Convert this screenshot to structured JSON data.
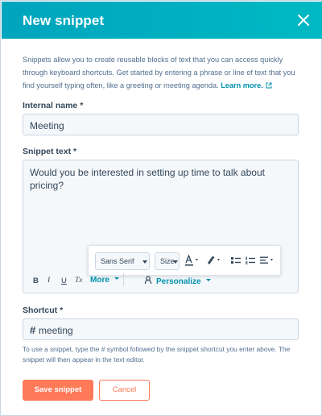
{
  "dialog": {
    "title": "New snippet",
    "close_icon": "close-icon"
  },
  "intro": {
    "text": "Snippets allow you to create reusable blocks of text that you can access quickly through keyboard shortcuts. Get started by entering a phrase or line of text that you find yourself typing often, like a greeting or meeting agenda.",
    "learn_more": "Learn more.",
    "learn_more_icon": "external-link-icon"
  },
  "internal_name": {
    "label": "Internal name *",
    "value": "Meeting"
  },
  "snippet_text": {
    "label": "Snippet text *",
    "value": "Would you be interested in setting up time to talk about pricing?"
  },
  "floating_toolbar": {
    "font_select": "Sans Serif",
    "size_select": "Size",
    "icons": [
      "text-color-icon",
      "highlight-icon",
      "bulleted-list-icon",
      "numbered-list-icon",
      "align-icon"
    ]
  },
  "bottom_toolbar": {
    "bold": "B",
    "italic": "I",
    "underline": "U",
    "clear_format": "Tx",
    "more": "More",
    "personalize": "Personalize",
    "personalize_icon": "personalize-icon"
  },
  "shortcut": {
    "label": "Shortcut *",
    "prefix": "#",
    "value": "meeting"
  },
  "hint": {
    "text": "To use a snippet, type the # symbol followed by the snippet shortcut you enter above. The snippet will then appear in the text editor."
  },
  "buttons": {
    "save": "Save snippet",
    "cancel": "Cancel"
  },
  "colors": {
    "header": "#00a4bd",
    "primary": "#ff7a59",
    "link": "#0091ae",
    "text": "#33475b"
  }
}
